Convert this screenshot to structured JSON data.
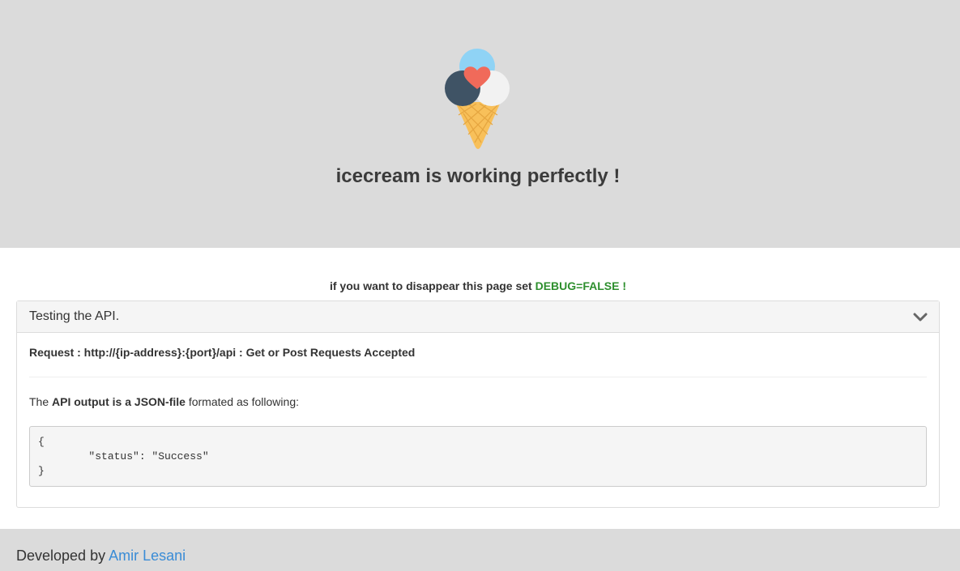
{
  "hero": {
    "title": "icecream is working perfectly !",
    "logo_icon": "icecream-cone-icon"
  },
  "debug_note": {
    "text": "if you want to disappear this page set",
    "flag": "DEBUG=FALSE !"
  },
  "panel": {
    "title": "Testing the API.",
    "toggle_icon": "chevron-down-icon",
    "request_line": "Request : http://{ip-address}:{port}/api : Get or Post Requests Accepted",
    "api_prefix": "The",
    "api_bold": "API output is a JSON-file",
    "api_suffix": "formated as following:",
    "code": "{\n        \"status\": \"Success\"\n}"
  },
  "footer": {
    "prefix": "Developed by",
    "author": "Amir Lesani"
  },
  "colors": {
    "hero_bg": "#dbdbdb",
    "flag_green": "#2e8f2e",
    "link_blue": "#3a8cd6"
  }
}
